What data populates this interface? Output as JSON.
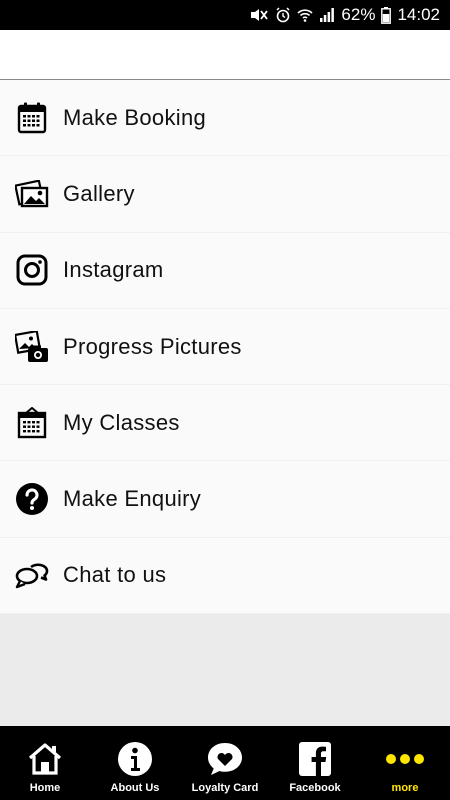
{
  "status_bar": {
    "battery_percent": "62%",
    "time": "14:02",
    "icons": [
      "mute-icon",
      "alarm-icon",
      "wifi-icon",
      "signal-icon",
      "battery-icon"
    ]
  },
  "menu": {
    "items": [
      {
        "label": "Make Booking",
        "icon": "calendar-icon"
      },
      {
        "label": "Gallery",
        "icon": "gallery-icon"
      },
      {
        "label": "Instagram",
        "icon": "instagram-icon"
      },
      {
        "label": "Progress Pictures",
        "icon": "photo-camera-icon"
      },
      {
        "label": "My Classes",
        "icon": "calendar-board-icon"
      },
      {
        "label": "Make Enquiry",
        "icon": "question-icon"
      },
      {
        "label": "Chat to us",
        "icon": "chat-icon"
      }
    ]
  },
  "tab_bar": {
    "tabs": [
      {
        "label": "Home",
        "icon": "home-icon"
      },
      {
        "label": "About Us",
        "icon": "info-icon"
      },
      {
        "label": "Loyalty Card",
        "icon": "heart-bubble-icon"
      },
      {
        "label": "Facebook",
        "icon": "facebook-icon"
      },
      {
        "label": "more",
        "icon": "more-dots-icon",
        "active": true
      }
    ],
    "active_color": "#ffe600"
  }
}
